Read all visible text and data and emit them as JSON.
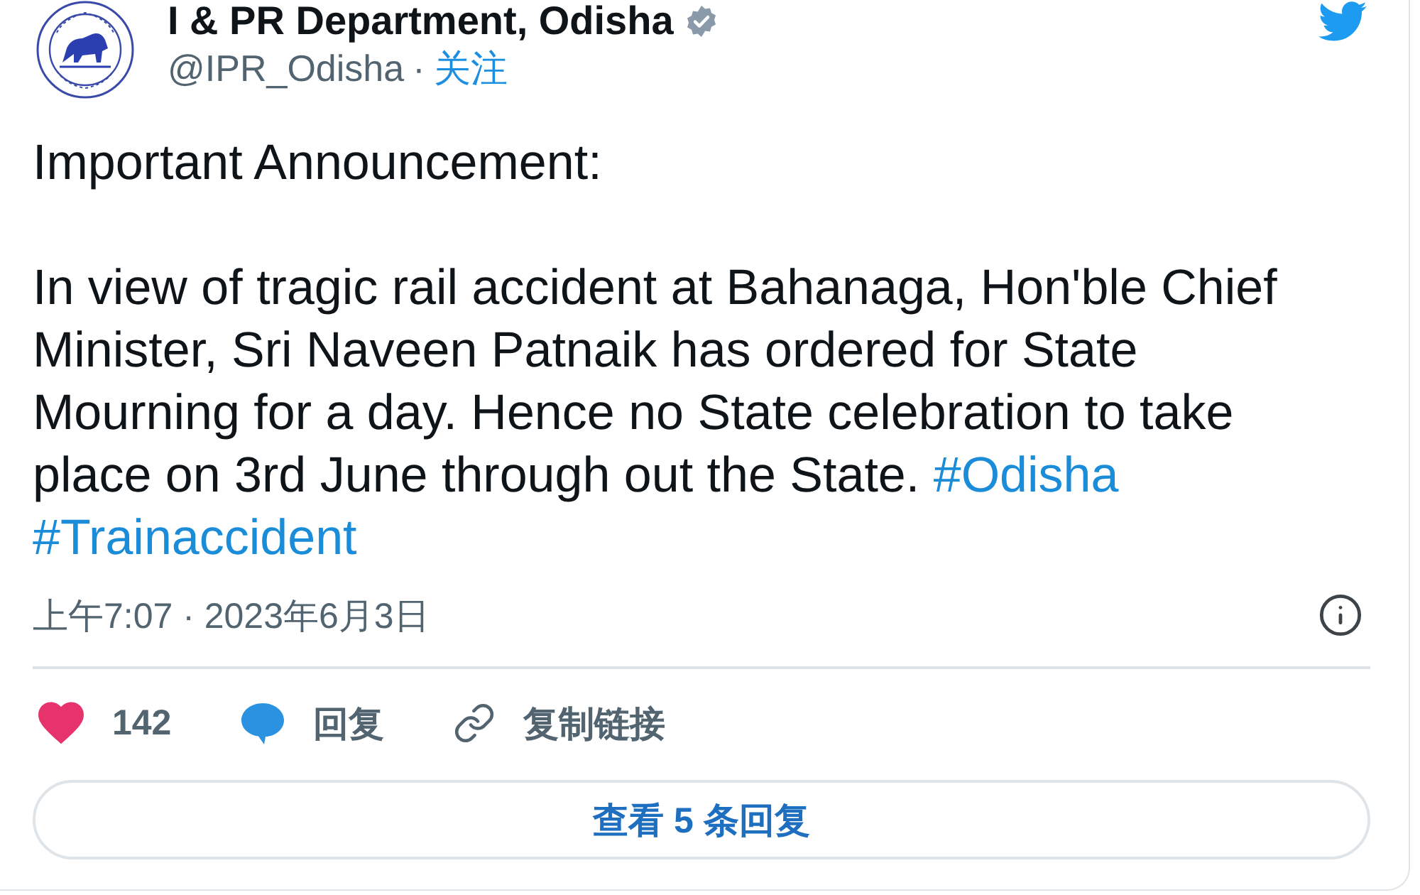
{
  "author": {
    "name": "I & PR Department, Odisha",
    "verified": true,
    "handle": "@IPR_Odisha",
    "separator": "·",
    "follow_label": "关注"
  },
  "tweet": {
    "heading": "Important Announcement:",
    "text": "In view of tragic rail accident at Bahanaga, Hon'ble Chief Minister, Sri Naveen Patnaik has ordered for State Mourning for a day. Hence no State celebration to take place on 3rd June through out the State.",
    "hashtags": [
      "#Odisha",
      "#Trainaccident"
    ],
    "timestamp": "上午7:07 · 2023年6月3日"
  },
  "actions": [
    {
      "kind": "like",
      "label": "142"
    },
    {
      "kind": "reply",
      "label": "回复"
    },
    {
      "kind": "copy_link",
      "label": "复制链接"
    }
  ],
  "more_replies_button": "查看 5 条回复"
}
